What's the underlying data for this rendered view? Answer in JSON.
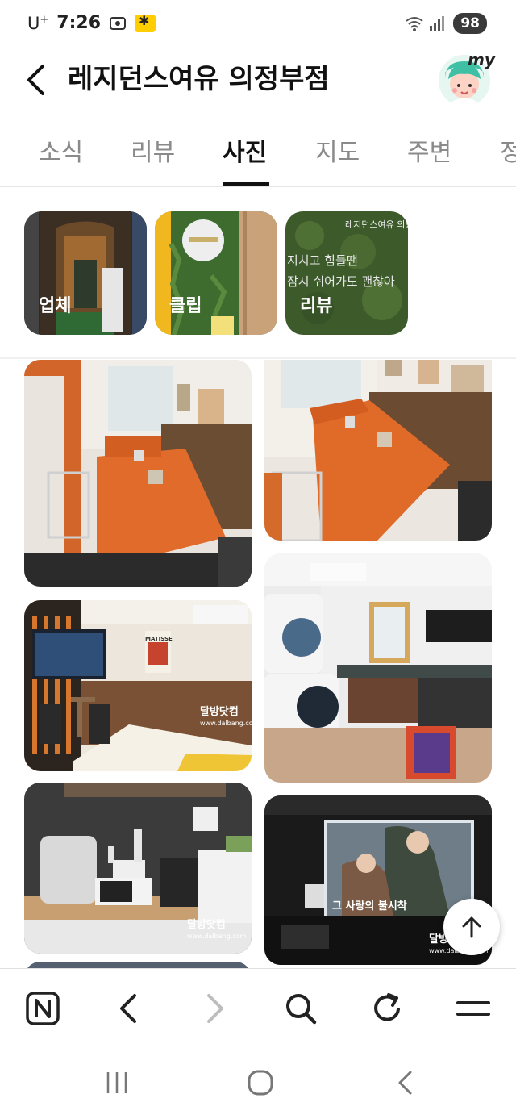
{
  "status_bar": {
    "carrier": "U",
    "carrier_sup": "+",
    "time": "7:26",
    "battery": "98"
  },
  "header": {
    "title": "레지던스여유 의정부점",
    "avatar_text": "my"
  },
  "tabs": [
    {
      "label": "소식",
      "active": false
    },
    {
      "label": "리뷰",
      "active": false
    },
    {
      "label": "사진",
      "active": true
    },
    {
      "label": "지도",
      "active": false
    },
    {
      "label": "주변",
      "active": false
    },
    {
      "label": "정",
      "active": false
    }
  ],
  "categories": [
    {
      "label": "업체"
    },
    {
      "label": "클립"
    },
    {
      "label": "리뷰",
      "overlay_top": "레지던스여유 의정",
      "overlay_lines": [
        "지치고 힘들땐",
        "잠시 쉬어가도 괜찮아"
      ]
    }
  ],
  "photos": {
    "watermark_title": "달방닷컴",
    "watermark_url": "www.dalbang.com",
    "poster_brand": "MATISSE",
    "movie_title": "그 사랑의 불시착"
  },
  "colors": {
    "accent_orange": "#e0702e",
    "tab_active": "#111111",
    "tab_inactive": "#8a8a8a"
  },
  "icons": {
    "back": "chevron-left-icon",
    "scroll_top": "arrow-up-icon",
    "naver": "naver-n-icon",
    "browser_back": "chevron-left-icon",
    "browser_forward": "chevron-right-icon",
    "search": "search-icon",
    "refresh": "refresh-icon",
    "menu": "menu-icon"
  }
}
